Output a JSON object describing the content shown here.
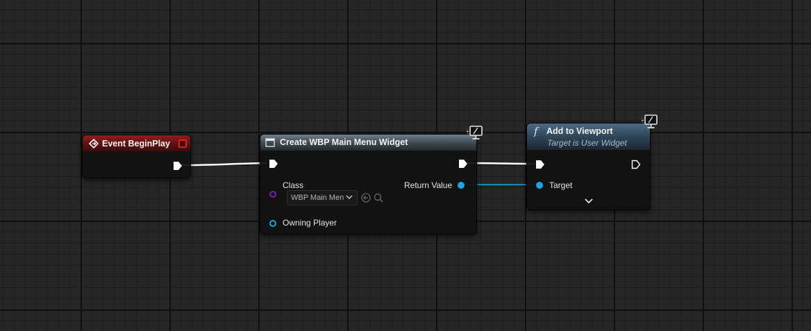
{
  "nodes": {
    "event_begin_play": {
      "title": "Event BeginPlay",
      "header_color": "#8f1f1f"
    },
    "create_widget": {
      "title": "Create WBP Main Menu Widget",
      "class_label": "Class",
      "class_value": "WBP Main Men",
      "owning_player_label": "Owning Player",
      "return_value_label": "Return Value"
    },
    "add_to_viewport": {
      "icon": "f",
      "title": "Add to Viewport",
      "subtitle": "Target is User Widget",
      "target_label": "Target"
    }
  },
  "colors": {
    "exec_wire": "#ffffff",
    "object_pin": "#1fa3e6",
    "class_pin": "#7a1fb0",
    "grid_background": "#262626"
  }
}
